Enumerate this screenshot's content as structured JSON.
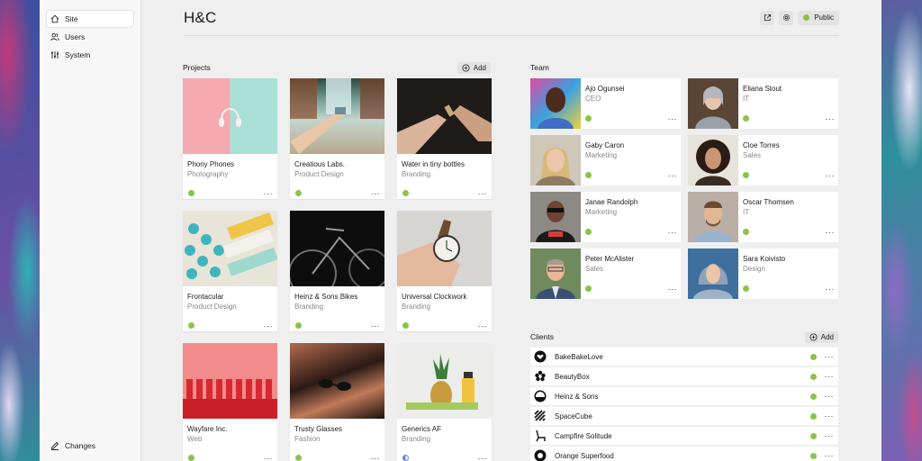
{
  "site": {
    "title": "H&C"
  },
  "topbar": {
    "public_label": "Public"
  },
  "sidebar": {
    "items": [
      {
        "label": "Site"
      },
      {
        "label": "Users"
      },
      {
        "label": "System"
      }
    ],
    "bottom_label": "Changes"
  },
  "projects": {
    "title": "Projects",
    "add_label": "Add",
    "items": [
      {
        "name": "Phony Phones",
        "category": "Photography",
        "status": "listed"
      },
      {
        "name": "Creatious Labs.",
        "category": "Product Design",
        "status": "listed"
      },
      {
        "name": "Water in tiny bottles",
        "category": "Branding",
        "status": "listed"
      },
      {
        "name": "Frontacular",
        "category": "Product Design",
        "status": "listed"
      },
      {
        "name": "Heinz & Sons Bikes",
        "category": "Branding",
        "status": "listed"
      },
      {
        "name": "Universal Clockwork",
        "category": "Branding",
        "status": "listed"
      },
      {
        "name": "Wayfare Inc.",
        "category": "Web",
        "status": "listed"
      },
      {
        "name": "Trusty Glasses",
        "category": "Fashion",
        "status": "listed"
      },
      {
        "name": "Generics AF",
        "category": "Branding",
        "status": "unlisted"
      }
    ]
  },
  "team": {
    "title": "Team",
    "members": [
      {
        "name": "Ajo Ogunsei",
        "role": "CEO"
      },
      {
        "name": "Eliana Stout",
        "role": "IT"
      },
      {
        "name": "Gaby Caron",
        "role": "Marketing"
      },
      {
        "name": "Cloe Torres",
        "role": "Sales"
      },
      {
        "name": "Janae Randolph",
        "role": "Marketing"
      },
      {
        "name": "Oscar Thomsen",
        "role": "IT"
      },
      {
        "name": "Peter McAlister",
        "role": "Sales"
      },
      {
        "name": "Sara Koivisto",
        "role": "Design"
      }
    ]
  },
  "clients": {
    "title": "Clients",
    "add_label": "Add",
    "items": [
      {
        "name": "BakeBakeLove"
      },
      {
        "name": "BeautyBox"
      },
      {
        "name": "Heinz & Sons"
      },
      {
        "name": "SpaceCube"
      },
      {
        "name": "Campfire Solitude"
      },
      {
        "name": "Orange Superfood"
      }
    ]
  },
  "more_glyph": "···",
  "colors": {
    "status_green": "#8bc34a",
    "status_blue": "#5b8bd6",
    "window_bg": "#efefef"
  }
}
